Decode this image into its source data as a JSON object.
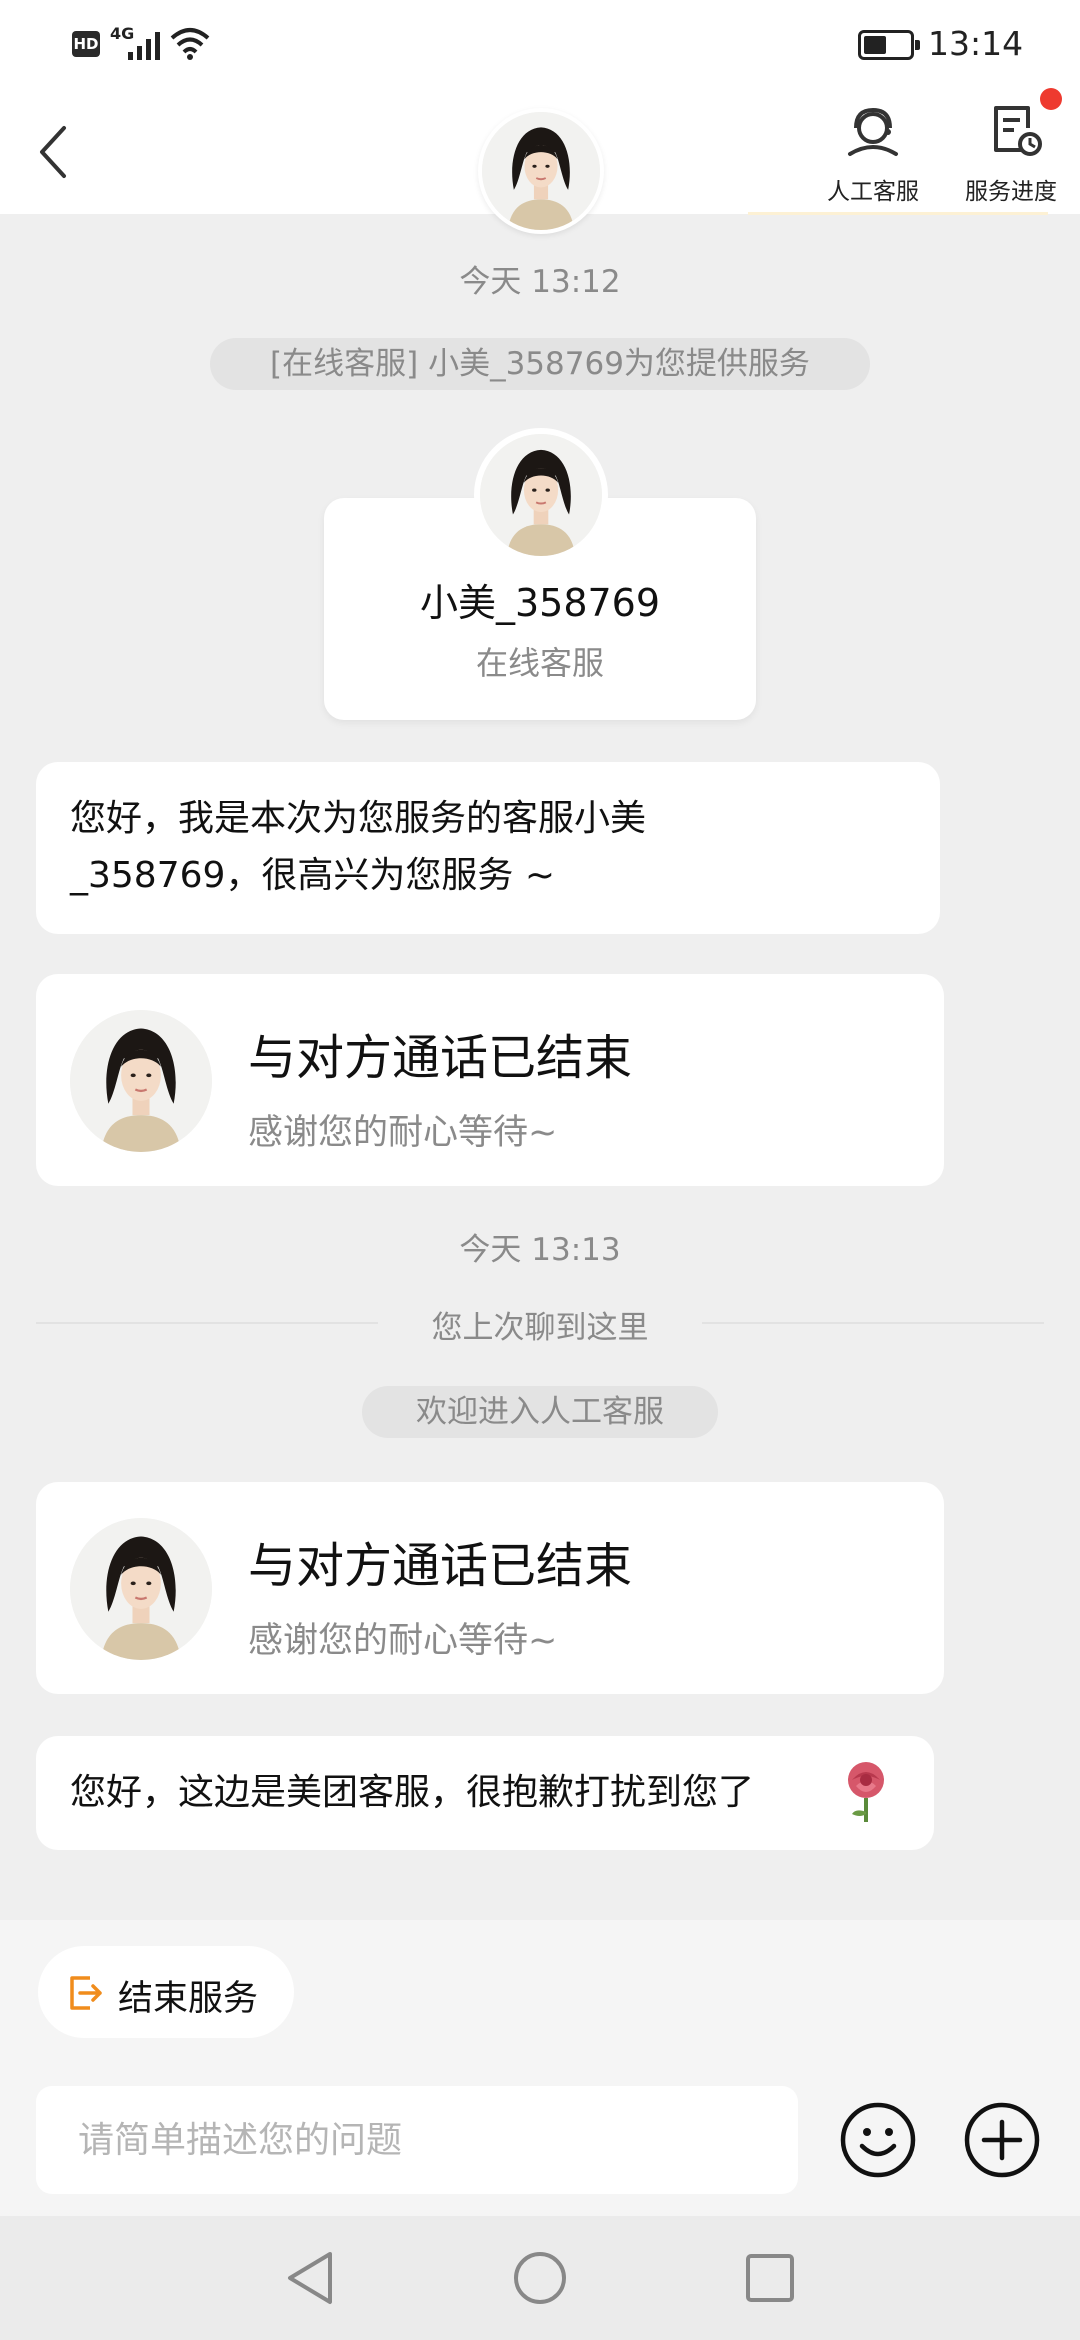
{
  "status_bar": {
    "hd_label": "HD",
    "network_label": "4G",
    "battery_level": 0.5,
    "time": "13:14"
  },
  "header": {
    "back_icon": "chevron-left-icon",
    "agent_button_label": "人工客服",
    "progress_button_label": "服务进度",
    "notification_dot_color": "#ee3a2f"
  },
  "chat": {
    "timestamp_1": "今天 13:12",
    "service_notice": "[在线客服] 小美_358769为您提供服务",
    "intro_card": {
      "name": "小美_358769",
      "role": "在线客服"
    },
    "greeting_lines": [
      "您好，我是本次为您服务的客服小美",
      "_358769，很高兴为您服务 ~"
    ],
    "call_ended_card_1": {
      "title": "与对方通话已结束",
      "subtitle": "感谢您的耐心等待~"
    },
    "timestamp_2": "今天 13:13",
    "last_read_divider": "您上次聊到这里",
    "welcome_notice": "欢迎进入人工客服",
    "call_ended_card_2": {
      "title": "与对方通话已结束",
      "subtitle": "感谢您的耐心等待~"
    },
    "apology_message": "您好，这边是美团客服，很抱歉打扰到您了",
    "apology_emoji": "rose-icon"
  },
  "bottom": {
    "end_service_label": "结束服务",
    "input_placeholder": "请简单描述您的问题",
    "emoji_icon": "smiley-icon",
    "plus_icon": "plus-circle-icon",
    "accent_color": "#f08c1c"
  },
  "nav_bar": {
    "back": "triangle-back-icon",
    "home": "circle-home-icon",
    "recent": "square-recent-icon"
  }
}
